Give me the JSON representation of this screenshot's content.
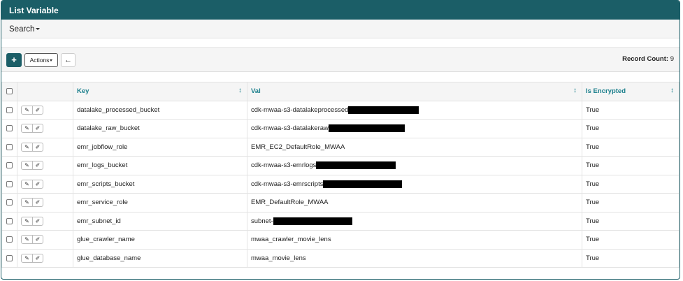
{
  "header": {
    "title": "List Variable"
  },
  "search": {
    "label": "Search"
  },
  "toolbar": {
    "add_label": "+",
    "actions_label": "Actions",
    "back_label": "←",
    "record_count_label": "Record Count:",
    "record_count_value": "9"
  },
  "table": {
    "columns": {
      "key": "Key",
      "val": "Val",
      "encrypted": "Is Encrypted",
      "sort_icon": "↕"
    },
    "rows": [
      {
        "key": "datalake_processed_bucket",
        "val": "cdk-mwaa-s3-datalakeprocessed",
        "redacted": true,
        "encrypted": "True"
      },
      {
        "key": "datalake_raw_bucket",
        "val": "cdk-mwaa-s3-datalakeraw",
        "redacted": true,
        "encrypted": "True"
      },
      {
        "key": "emr_jobflow_role",
        "val": "EMR_EC2_DefaultRole_MWAA",
        "redacted": false,
        "encrypted": "True"
      },
      {
        "key": "emr_logs_bucket",
        "val": "cdk-mwaa-s3-emrlogs",
        "redacted": true,
        "encrypted": "True"
      },
      {
        "key": "emr_scripts_bucket",
        "val": "cdk-mwaa-s3-emrscripts",
        "redacted": true,
        "encrypted": "True"
      },
      {
        "key": "emr_service_role",
        "val": "EMR_DefaultRole_MWAA",
        "redacted": false,
        "encrypted": "True"
      },
      {
        "key": "emr_subnet_id",
        "val": "subnet-",
        "redacted": true,
        "encrypted": "True"
      },
      {
        "key": "glue_crawler_name",
        "val": "mwaa_crawler_movie_lens",
        "redacted": false,
        "encrypted": "True"
      },
      {
        "key": "glue_database_name",
        "val": "mwaa_movie_lens",
        "redacted": false,
        "encrypted": "True"
      }
    ]
  }
}
